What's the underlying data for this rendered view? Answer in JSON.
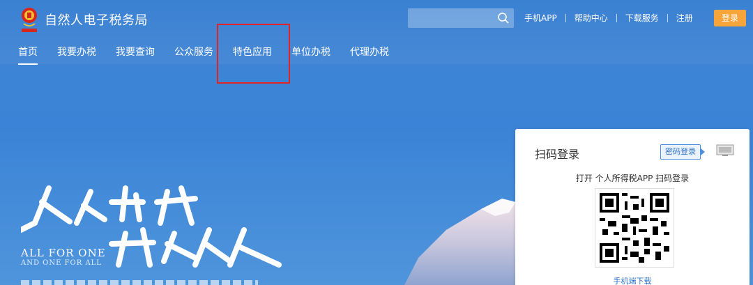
{
  "header": {
    "site_title": "自然人电子税务局",
    "search": {
      "placeholder": ""
    },
    "links": [
      "手机APP",
      "帮助中心",
      "下载服务",
      "注册"
    ],
    "login_label": "登录",
    "login_color": "#f7a43a"
  },
  "nav": {
    "items": [
      "首页",
      "我要办税",
      "我要查询",
      "公众服务",
      "特色应用",
      "单位办税",
      "代理办税"
    ],
    "active_index": 0
  },
  "hero": {
    "motto_line1": "ALL FOR ONE",
    "motto_line2": "AND ONE FOR ALL"
  },
  "login_card": {
    "title": "扫码登录",
    "password_login_label": "密码登录",
    "scan_hint": "打开 个人所得税APP 扫码登录",
    "download_link": "手机端下载"
  },
  "colors": {
    "primary_blue": "#3b81d2",
    "highlight_red": "#e02424",
    "link_blue": "#2f73c8"
  },
  "icons": [
    "national-emblem-icon",
    "search-icon",
    "pc-login-icon",
    "qr-code"
  ]
}
